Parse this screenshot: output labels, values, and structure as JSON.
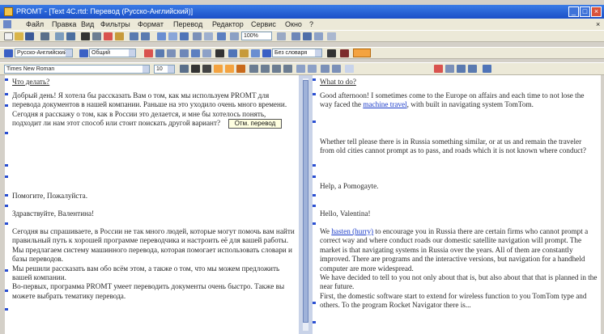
{
  "titlebar": {
    "title": "PROMT - [Text 4C.rtd: Пeрeвoд (Русско-Английский)]",
    "buttons": [
      "_",
      "□",
      "×"
    ]
  },
  "menubar": {
    "items": [
      "Файл",
      "Правка",
      "Вид",
      "Фильтры",
      "Формат",
      "Пеpевод",
      "Редактор",
      "Сервис",
      "Окно",
      "?"
    ]
  },
  "toolbar_top": {
    "zoom": "100%"
  },
  "toolbar_middle": {
    "direction": "Русско-Английский",
    "subject": "Общий",
    "dictionary": "Без словаря"
  },
  "toolbar_format": {
    "font": "Times New Roman",
    "size": "10"
  },
  "tooltip": {
    "text": "Отм. перевод"
  },
  "left_pane": {
    "segments": [
      {
        "text": "Что делать?",
        "head": true
      },
      {
        "text": "Добрый день! Я хотела бы рассказать Вам о том, как мы используем PROMT для перевода документов в нашей компании. Раньше на это уходило очень много времени.\nСегодня я расскажу о том, как в России это делается, и мне бы хотелось понять, подходит ли нам этот способ или стоит поискать другой вариант?"
      },
      {
        "text": "Помогите, Пожалуйста."
      },
      {
        "text": "Здравствуйте, Валентина!"
      },
      {
        "text": "Сегодня вы спрашиваете, в России не так много людей, которые могут помочь вам найти правильный путь к хорошей программе переводчика и настроить её для вашей работы. Мы предлагаем систему машинного перевода, которая помогает использовать словари и базы переводов.\nМы решили рассказать вам обо всём этом, а также о том, что мы можем предложить вашей компании.\nВо-первых, программа PROMT умеет переводить документы очень быстро. Также вы можете выбрать тематику перевода."
      }
    ]
  },
  "right_pane": {
    "segments": [
      {
        "text": "What to do?",
        "head": true
      },
      {
        "text": "Good afternoon! I sometimes come to the Europe on affairs and each time to not lose the way faced the ",
        "link": "machine travel",
        "after": ", with built in navigating system TomTom."
      },
      {
        "text": "Whether tell please there is in Russia something similar, or at us and remain the traveler from old cities cannot prompt as to pass, and roads which it is not known where conduct?"
      },
      {
        "text": "Help, a Pomogayte."
      },
      {
        "text": "Hello, Valentina!"
      },
      {
        "text": "We ",
        "link": "hasten (hurry)",
        "after": " to encourage you in Russia there are certain firms who cannot prompt a correct way and where conduct roads our domestic satellite navigation will prompt. The market is that navigating systems in Russia over the years. All of them are constantly improved. There are programs and the interactive versions, but navigation for a handheld computer are more widespread.\nWe have decided to tell to you not only about that is, but also about that that is planned in the near future.\nFirst, the domestic software start to extend for wireless function to you TomTom type and others. To the program Rocket Navigator there is..."
      }
    ]
  }
}
